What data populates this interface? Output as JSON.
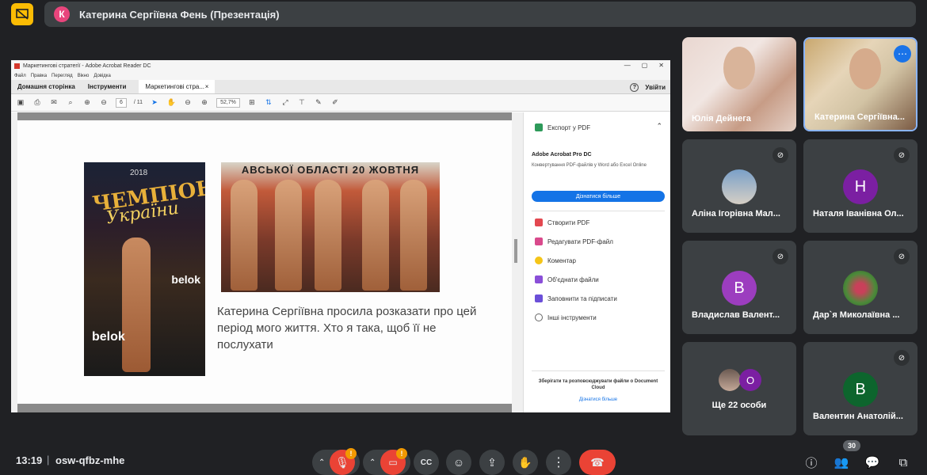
{
  "colors": {
    "accent": "#fbbc04",
    "end_call": "#ea4335",
    "adobe_blue": "#1473e6",
    "tile_bg": "#3c4043"
  },
  "topbar": {
    "presenter_initial": "К",
    "presenter_label": "Катерина Сергіївна Фень (Презентація)"
  },
  "acrobat": {
    "window_title": "Маркетингові стратегії - Adobe Acrobat Reader DC",
    "window_controls": [
      "—",
      "▢",
      "✕"
    ],
    "menu": [
      "Файл",
      "Правка",
      "Перегляд",
      "Вікно",
      "Довідка"
    ],
    "tabs": {
      "home": "Домашня сторінка",
      "tools": "Інструменти",
      "doc": "Маркетингові стра...",
      "doc_close": "×"
    },
    "sign_in": "Увійти",
    "toolbar": {
      "page_current": "6",
      "page_total": "/ 11",
      "zoom": "52,7%"
    },
    "slide": {
      "photo1_line1": "ЧЕМПІОНАТ",
      "photo1_line2": "України",
      "photo1_year": "2018",
      "photo1_brand": "belok",
      "photo2_banner": "АВСЬКОЇ ОБЛАСТІ 20 ЖОВТНЯ",
      "text": "Катерина Сергіївна просила розказати про цей період мого життя. Хто я така, щоб її не послухати"
    },
    "right_pane": {
      "export": "Експорт у PDF",
      "acro_title": "Adobe Acrobat Pro DC",
      "acro_desc": "Конвертування PDF-файлів у Word або Excel Online",
      "acro_button": "Дізнатися більше",
      "tools": [
        "Створити PDF",
        "Редагувати PDF-файл",
        "Коментар",
        "Об'єднати файли",
        "Заповнити та підписати",
        "Інші інструменти"
      ],
      "cloud_text": "Зберігати та розповсюджувати файли о Document Cloud",
      "cloud_link": "Дізнатися більше"
    }
  },
  "participants": [
    {
      "name": "Юлія Дейнега",
      "type": "video"
    },
    {
      "name": "Катерина Сергіївна...",
      "type": "video"
    },
    {
      "name": "Аліна Ігорівна Мал...",
      "type": "photo",
      "muted": true
    },
    {
      "name": "Наталя Іванівна Ол...",
      "initial": "Н",
      "color": "#7b1fa2",
      "muted": true
    },
    {
      "name": "Владислав Валент...",
      "initial": "В",
      "color": "#9c3dbf",
      "muted": true
    },
    {
      "name": "Дар`я Миколаївна ...",
      "type": "photo",
      "muted": true
    },
    {
      "name": "Ще 22 особи",
      "initial": "О",
      "color": "#7b1fa2"
    },
    {
      "name": "Валентин Анатолій...",
      "initial": "В",
      "color": "#0d652d",
      "muted": true
    }
  ],
  "bottom": {
    "time": "13:19",
    "divider": "|",
    "meeting_code": "osw-qfbz-mhe",
    "mic_badge": "!",
    "cam_badge": "!",
    "participant_count": "30"
  }
}
